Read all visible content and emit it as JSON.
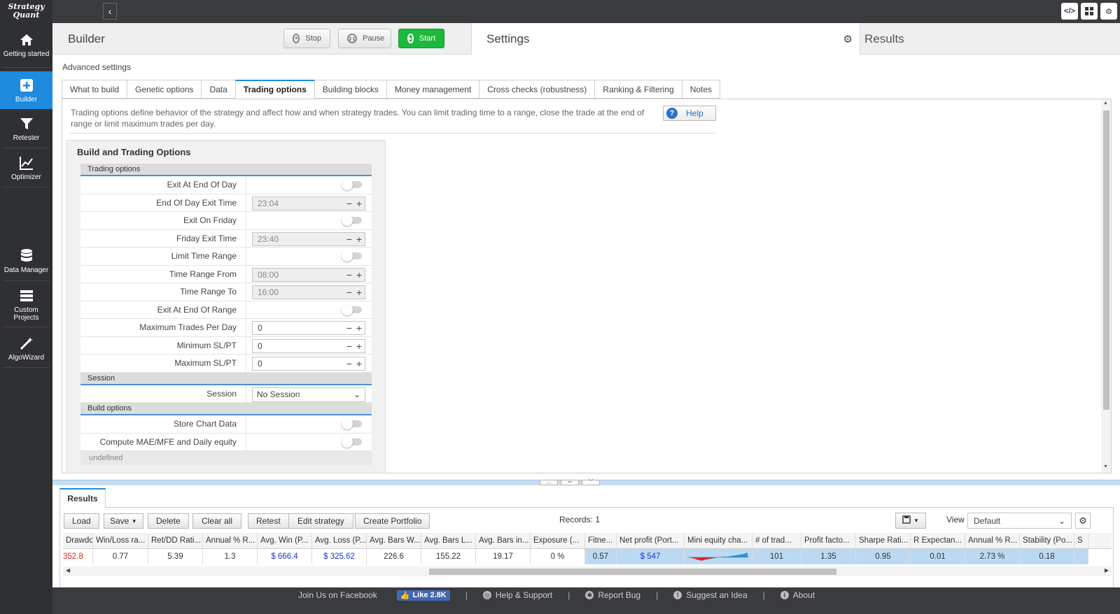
{
  "app": {
    "logo_line1": "Strategy",
    "logo_line2": "Quant"
  },
  "sidebar": {
    "items": [
      {
        "label": "Getting started",
        "icon": "home-icon"
      },
      {
        "label": "Builder",
        "icon": "plus-square-icon",
        "active": true
      },
      {
        "label": "Retester",
        "icon": "funnel-icon"
      },
      {
        "label": "Optimizer",
        "icon": "chart-line-icon"
      },
      {
        "label": "Data Manager",
        "icon": "database-icon"
      },
      {
        "label": "Custom Projects",
        "icon": "list-icon"
      },
      {
        "label": "AlgoWizard",
        "icon": "magic-wand-icon"
      }
    ]
  },
  "header": {
    "builder_title": "Builder",
    "stop_label": "Stop",
    "pause_label": "Pause",
    "start_label": "Start",
    "settings_title": "Settings",
    "results_title": "Results"
  },
  "main": {
    "advanced_settings": "Advanced settings",
    "tabs": [
      {
        "label": "What to build"
      },
      {
        "label": "Genetic options"
      },
      {
        "label": "Data"
      },
      {
        "label": "Trading options",
        "active": true
      },
      {
        "label": "Building blocks"
      },
      {
        "label": "Money management"
      },
      {
        "label": "Cross checks (robustness)"
      },
      {
        "label": "Ranking & Filtering"
      },
      {
        "label": "Notes"
      }
    ],
    "description": "Trading options define behavior of the strategy and affect how and when strategy trades. You can limit trading time to a range, close the trade at the end of range or limit maximum trades per day.",
    "help_label": "Help"
  },
  "options": {
    "title": "Build and Trading Options",
    "trading_section": "Trading options",
    "rows": [
      {
        "label": "Exit At End Of Day",
        "type": "toggle",
        "on": false
      },
      {
        "label": "End Of Day Exit Time",
        "type": "time",
        "value": "23:04",
        "disabled": true
      },
      {
        "label": "Exit On Friday",
        "type": "toggle",
        "on": false
      },
      {
        "label": "Friday Exit Time",
        "type": "time",
        "value": "23:40",
        "disabled": true
      },
      {
        "label": "Limit Time Range",
        "type": "toggle",
        "on": false
      },
      {
        "label": "Time Range From",
        "type": "time",
        "value": "08:00",
        "disabled": true
      },
      {
        "label": "Time Range To",
        "type": "time",
        "value": "16:00",
        "disabled": true
      },
      {
        "label": "Exit At End Of Range",
        "type": "toggle",
        "on": false
      },
      {
        "label": "Maximum Trades Per Day",
        "type": "number",
        "value": "0"
      },
      {
        "label": "Minimum SL/PT",
        "type": "number",
        "value": "0"
      },
      {
        "label": "Maximum SL/PT",
        "type": "number",
        "value": "0"
      }
    ],
    "session_section": "Session",
    "session_label": "Session",
    "session_value": "No Session",
    "build_section": "Build options",
    "build_rows": [
      {
        "label": "Store Chart Data",
        "on": false
      },
      {
        "label": "Compute MAE/MFE and Daily equity",
        "on": false
      }
    ],
    "undefined_text": "undefined"
  },
  "results": {
    "tab_label": "Results",
    "buttons": {
      "load": "Load",
      "save": "Save",
      "delete": "Delete",
      "clear_all": "Clear all",
      "retest": "Retest",
      "edit_strategy": "Edit strategy",
      "create_portfolio": "Create Portfolio"
    },
    "records": "Records: 1",
    "view_label": "View",
    "view_value": "Default",
    "columns": [
      {
        "label": "Drawdown ...",
        "value": "352.8",
        "color": "red"
      },
      {
        "label": "Win/Loss ra...",
        "value": "0.77"
      },
      {
        "label": "Ret/DD Rati...",
        "value": "5.39"
      },
      {
        "label": "Annual % R...",
        "value": "1.3"
      },
      {
        "label": "Avg. Win (P...",
        "value": "$ 666.4",
        "color": "blue"
      },
      {
        "label": "Avg. Loss (P...",
        "value": "$ 325.62",
        "color": "blue"
      },
      {
        "label": "Avg. Bars W...",
        "value": "226.6"
      },
      {
        "label": "Avg. Bars L...",
        "value": "155.22"
      },
      {
        "label": "Avg. Bars in...",
        "value": "19.17"
      },
      {
        "label": "Exposure (...",
        "value": "0 %"
      },
      {
        "label": "Fitne...",
        "value": "0.57",
        "hl": true
      },
      {
        "label": "Net profit (Port...",
        "value": "$ 547",
        "color": "blue",
        "hl": true
      },
      {
        "label": "Mini equity cha...",
        "value": "",
        "chart": true,
        "hl": true
      },
      {
        "label": "# of trad...",
        "value": "101",
        "hl": true
      },
      {
        "label": "Profit facto...",
        "value": "1.35",
        "hl": true
      },
      {
        "label": "Sharpe Rati...",
        "value": "0.95",
        "hl": true
      },
      {
        "label": "R Expectan...",
        "value": "0.01",
        "hl": true
      },
      {
        "label": "Annual % R...",
        "value": "2.73 %",
        "hl": true
      },
      {
        "label": "Stability (Po...",
        "value": "0.18",
        "hl": true
      },
      {
        "label": "S",
        "value": "",
        "hl": true
      }
    ]
  },
  "footer": {
    "facebook": "Join Us on Facebook",
    "like": "Like 2.8K",
    "help": "Help & Support",
    "bug": "Report Bug",
    "idea": "Suggest an Idea",
    "about": "About"
  }
}
